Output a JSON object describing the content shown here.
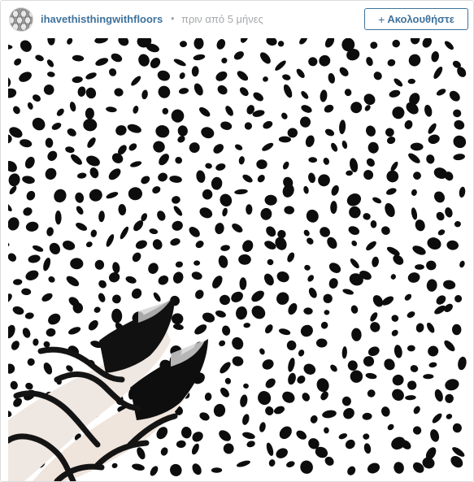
{
  "post": {
    "username": "ihavethisthingwithfloors",
    "separator": "•",
    "time_ago": "πριν από 5 μήνες",
    "follow_label": "Ακολουθήστε",
    "follow_icon": "+",
    "avatar_icon": "avatar-hexagon-tile-icon",
    "photo_subject": "dalmatian-spot-floor-with-black-strappy-heels"
  },
  "colors": {
    "link": "#3f729b",
    "muted": "#a5a7aa",
    "spot": "#0d0d0d",
    "background": "#ffffff"
  }
}
